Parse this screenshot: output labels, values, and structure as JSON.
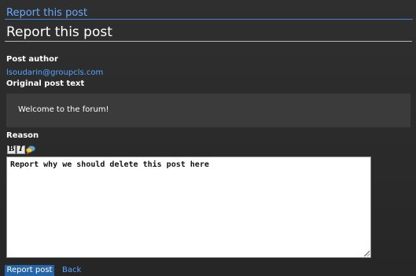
{
  "page": {
    "top_title": "Report this post",
    "heading": "Report this post"
  },
  "author": {
    "label": "Post author",
    "value": "lsoudarin@groupcls.com"
  },
  "original": {
    "label": "Original post text",
    "text": "Welcome to the forum!"
  },
  "reason": {
    "label": "Reason",
    "toolbar": {
      "bold_label": "B",
      "italic_label": "I",
      "quote_icon": "speech-bubble-icon"
    },
    "textarea_value": "Report why we should delete this post here"
  },
  "actions": {
    "report_label": "Report post",
    "back_label": "Back"
  },
  "colors": {
    "background": "#2e2e2e",
    "accent": "#56a3ff",
    "button": "#2664a6",
    "panel": "#3b3b3b"
  }
}
